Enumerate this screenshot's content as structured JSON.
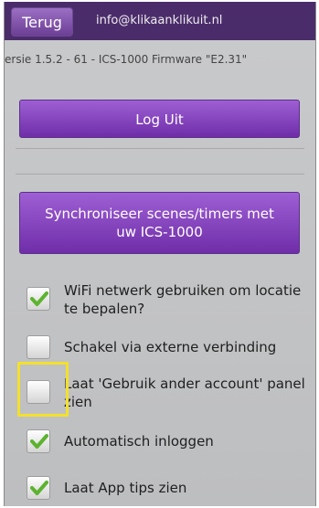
{
  "topbar": {
    "back_label": "Terug",
    "email": "info@klikaanklikuit.nl"
  },
  "version_text": "ersie 1.5.2 - 61 - ICS-1000 Firmware \"E2.31\"",
  "buttons": {
    "logout_label": "Log Uit",
    "sync_line1": "Synchroniseer scenes/timers met",
    "sync_line2": "uw ICS-1000"
  },
  "options": [
    {
      "line1": "WiFi netwerk gebruiken om locatie",
      "line2": "te bepalen?",
      "checked": true
    },
    {
      "line1": "Schakel via externe verbinding",
      "line2": "",
      "checked": false
    },
    {
      "line1": "Laat 'Gebruik ander account' panel",
      "line2": "zien",
      "checked": false
    },
    {
      "line1": "Automatisch inloggen",
      "line2": "",
      "checked": true
    },
    {
      "line1": "Laat App tips zien",
      "line2": "",
      "checked": true
    }
  ],
  "colors": {
    "topbar": "#4b2c6b",
    "button": "#8a4bc4",
    "check": "#5db32f",
    "highlight": "#f3e02c"
  }
}
